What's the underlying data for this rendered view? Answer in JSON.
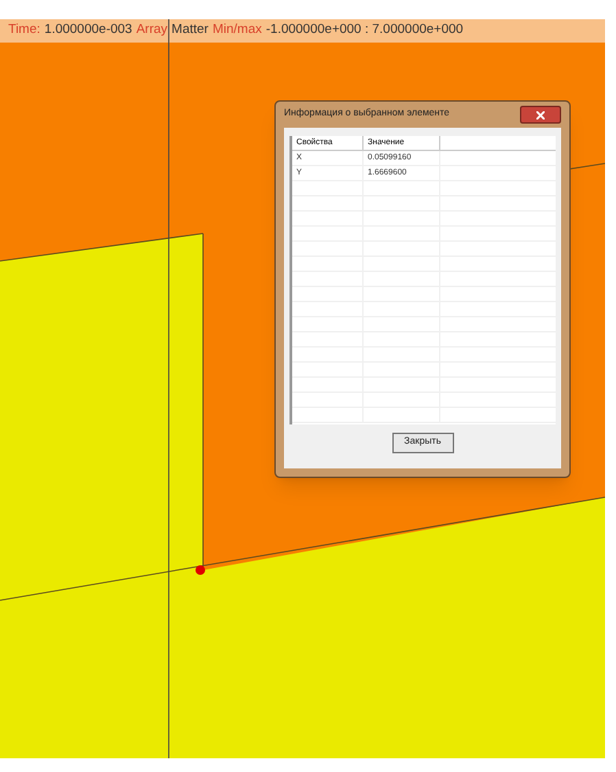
{
  "status_bar": [
    {
      "kind": "label",
      "text": "Time:"
    },
    {
      "kind": "value",
      "text": "1.000000e-003"
    },
    {
      "kind": "label",
      "text": "Array"
    },
    {
      "kind": "value",
      "text": "Matter"
    },
    {
      "kind": "label",
      "text": "Min/max"
    },
    {
      "kind": "value",
      "text": "-1.000000e+000 : 7.000000e+000"
    }
  ],
  "dialog": {
    "title": "Информация о выбранном элементе",
    "columns": [
      "Свойства",
      "Значение"
    ],
    "rows": [
      {
        "property": "X",
        "value": "0.05099160"
      },
      {
        "property": "Y",
        "value": "1.6669600"
      }
    ],
    "close_button": "Закрыть"
  }
}
